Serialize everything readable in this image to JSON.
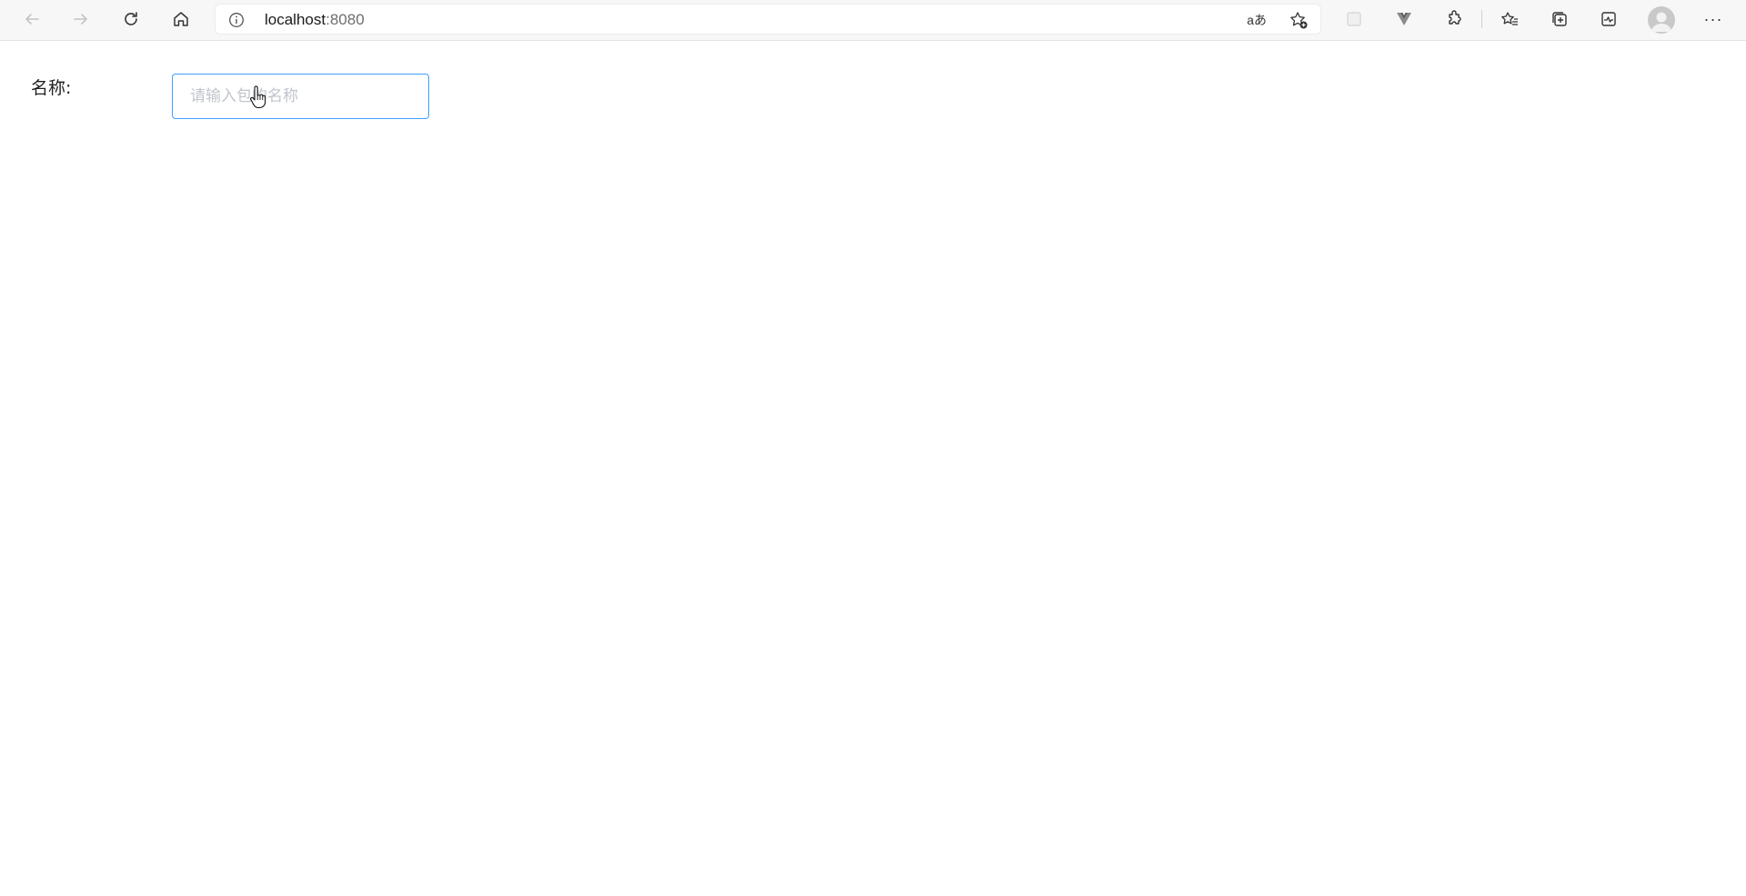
{
  "browser": {
    "address": {
      "host": "localhost",
      "port": ":8080"
    },
    "icons": {
      "back": "arrow-left",
      "forward": "arrow-right",
      "refresh": "refresh",
      "home": "home",
      "site_info": "info",
      "read_aloud": "aA",
      "add_favorite": "star-plus",
      "extension_placeholder": "square",
      "vue_devtools": "vue",
      "extensions": "puzzle",
      "favorites": "star-list",
      "collections": "collections",
      "browser_essentials": "heart-pulse",
      "profile": "user",
      "menu": "ellipsis"
    },
    "read_aloud_label": "aあ",
    "menu_label": "···"
  },
  "form": {
    "name_label": "名称:",
    "name_input": {
      "value": "",
      "placeholder": "请输入包的名称"
    }
  },
  "colors": {
    "focus_border": "#409eff",
    "placeholder": "#c0c4cc"
  }
}
